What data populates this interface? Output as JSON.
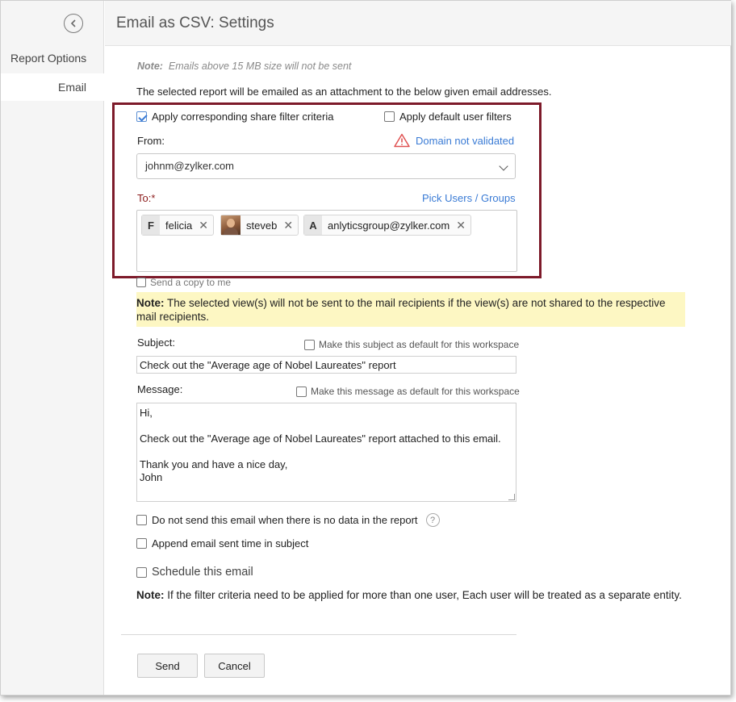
{
  "header": {
    "title": "Email as CSV: Settings"
  },
  "sidebar": {
    "back_icon": "chevron-left-circle-icon",
    "heading": "Report Options",
    "items": [
      {
        "label": "Email",
        "selected": true
      }
    ]
  },
  "form": {
    "size_note_prefix": "Note:",
    "size_note_text": "Emails above 15 MB size will not be sent",
    "intro": "The selected report will be emailed as an attachment to the below given email addresses.",
    "share_filter": {
      "label": "Apply corresponding share filter criteria",
      "checked": true
    },
    "default_filter": {
      "label": "Apply default user filters",
      "checked": false
    },
    "from": {
      "label": "From:",
      "value": "johnm@zylker.com",
      "domain_warning": "Domain not validated",
      "warning_icon": "warning-triangle-icon",
      "warning_color": "#e05252"
    },
    "to": {
      "label": "To:*",
      "pick_link": "Pick Users / Groups",
      "recipients": [
        {
          "initial": "F",
          "name": "felicia"
        },
        {
          "initial": "",
          "name": "steveb",
          "avatar": true
        },
        {
          "initial": "A",
          "name": "anlyticsgroup@zylker.com"
        }
      ]
    },
    "send_copy": {
      "label": "Send a copy to me",
      "checked": false
    },
    "view_note_prefix": "Note:",
    "view_note_text": "The selected view(s) will not be sent to the mail recipients if the view(s) are not shared to the respective mail recipients.",
    "subject": {
      "label": "Subject:",
      "default_label": "Make this subject as default for this workspace",
      "value": "Check out the \"Average age of Nobel Laureates\" report"
    },
    "message": {
      "label": "Message:",
      "default_label": "Make this message as default for this workspace",
      "lines": [
        "Hi,",
        "",
        "Check out the \"Average age of Nobel Laureates\" report attached to this email.",
        "",
        "Thank you and have a nice day,",
        "John"
      ]
    },
    "no_data": {
      "label": "Do not send this email when there is no data in the report",
      "checked": false,
      "help": "?"
    },
    "append_time": {
      "label": "Append email sent time in subject",
      "checked": false
    },
    "schedule": {
      "label": "Schedule this email",
      "checked": false
    },
    "bottom_note_prefix": "Note:",
    "bottom_note_text": "If the filter criteria need to be applied for more than one user, Each user will be treated as a separate entity."
  },
  "buttons": {
    "send": "Send",
    "cancel": "Cancel"
  },
  "colors": {
    "link": "#3a7bd5",
    "highlight_border": "#7d1a2a",
    "note_bg": "#fdf7c3",
    "required_label": "#8b1a1a"
  }
}
